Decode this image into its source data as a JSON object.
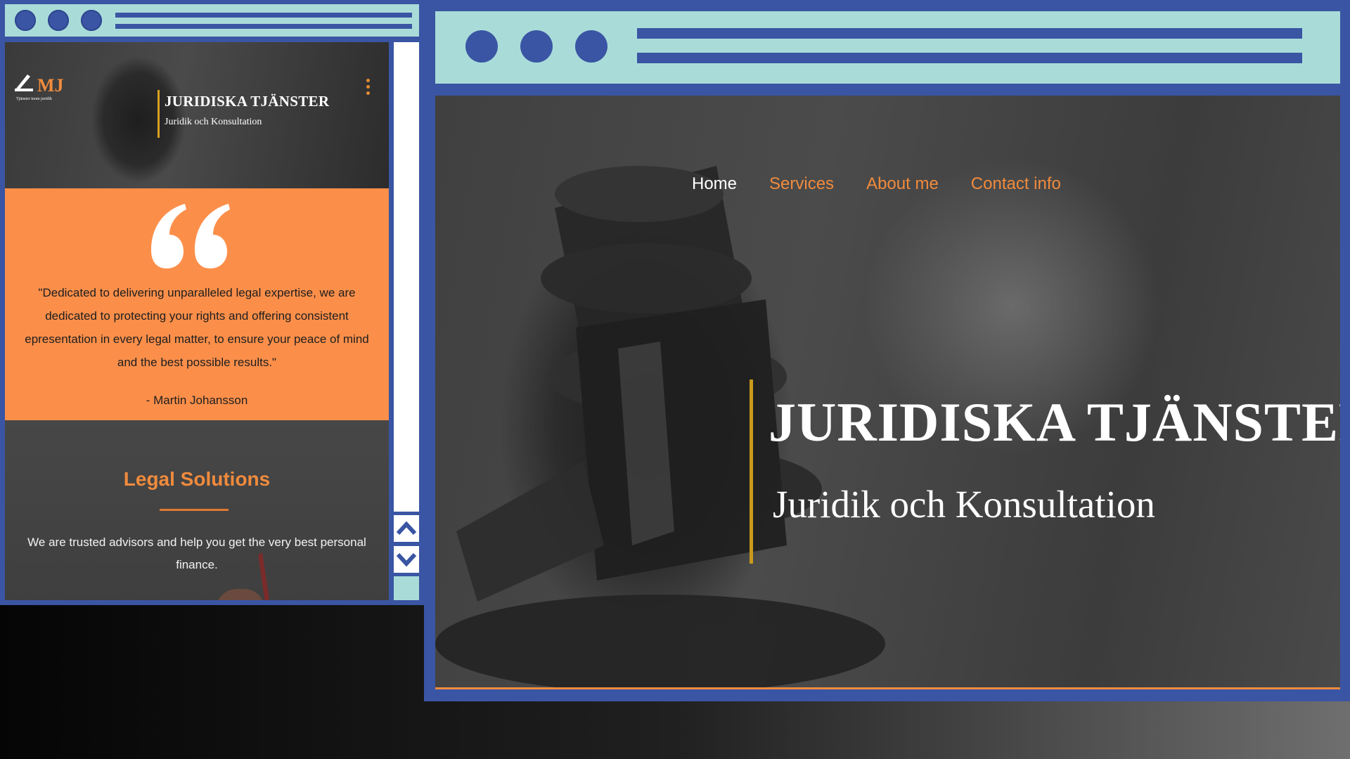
{
  "mobile": {
    "brand": {
      "logo_text": "MJ",
      "logo_tagline": "Tjänster inom juridik",
      "title": "JURIDISKA TJÄNSTER",
      "subtitle": "Juridik och Konsultation"
    },
    "quote": {
      "text": "\"Dedicated to delivering unparalleled legal expertise, we are\ndedicated to protecting your rights and offering consistent\nepresentation in every legal matter, to ensure your peace of mind\nand the best possible results.\"",
      "author": "- Martin Johansson"
    },
    "legal": {
      "title": "Legal Solutions",
      "text": "We are trusted advisors and help you get the very best personal\nfinance."
    }
  },
  "desktop": {
    "nav": {
      "items": [
        {
          "label": "Home",
          "active": true
        },
        {
          "label": "Services",
          "active": false
        },
        {
          "label": "About me",
          "active": false
        },
        {
          "label": "Contact info",
          "active": false
        }
      ]
    },
    "hero": {
      "title": "JURIDISKA TJÄNSTER",
      "subtitle": "Juridik och Konsultation"
    }
  },
  "icons": {
    "quote": "quote-icon",
    "menu": "kebab-menu-icon",
    "scroll_up": "chevron-up-icon",
    "scroll_down": "chevron-down-icon"
  },
  "colors": {
    "frame": "#3a55a3",
    "titlebar": "#a9dcd9",
    "accent_orange": "#fb8f4a",
    "nav_orange": "#f08b3d",
    "gold": "#c99a1b"
  }
}
